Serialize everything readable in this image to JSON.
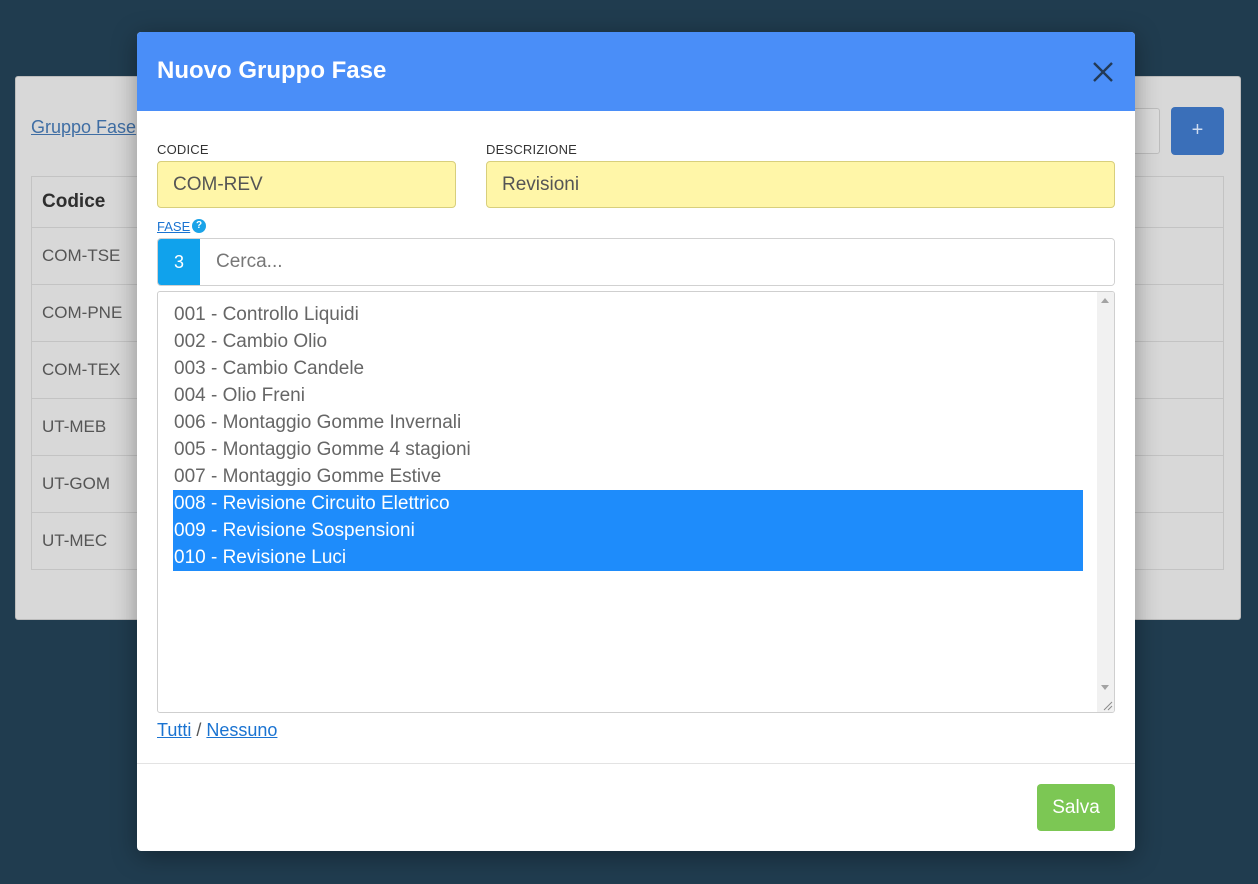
{
  "background": {
    "breadcrumb": "Gruppo Fase",
    "add_button": "+",
    "table_header": "Codice",
    "rows": [
      "COM-TSE",
      "COM-PNE",
      "COM-TEX",
      "UT-MEB",
      "UT-GOM",
      "UT-MEC"
    ]
  },
  "modal": {
    "title": "Nuovo Gruppo Fase",
    "codice": {
      "label": "CODICE",
      "value": "COM-REV"
    },
    "descrizione": {
      "label": "DESCRIZIONE",
      "value": "Revisioni"
    },
    "fase": {
      "label": "FASE",
      "help": "?",
      "selected_count": "3",
      "search_placeholder": "Cerca...",
      "options": [
        {
          "label": "001 - Controllo Liquidi",
          "selected": false
        },
        {
          "label": "002 - Cambio Olio",
          "selected": false
        },
        {
          "label": "003 - Cambio Candele",
          "selected": false
        },
        {
          "label": "004 - Olio Freni",
          "selected": false
        },
        {
          "label": "006 - Montaggio Gomme Invernali",
          "selected": false
        },
        {
          "label": "005 - Montaggio Gomme 4 stagioni",
          "selected": false
        },
        {
          "label": "007 - Montaggio Gomme Estive",
          "selected": false
        },
        {
          "label": "008 - Revisione Circuito Elettrico",
          "selected": true
        },
        {
          "label": "009 - Revisione Sospensioni",
          "selected": true
        },
        {
          "label": "010 - Revisione Luci",
          "selected": true
        }
      ]
    },
    "select_all": "Tutti",
    "separator": "/",
    "select_none": "Nessuno",
    "save_button": "Salva"
  },
  "colors": {
    "header": "#4a8ef8",
    "selection": "#1e8cfb",
    "input_highlight": "#fff6a8",
    "save": "#7cc754",
    "badge": "#10a2ec"
  }
}
